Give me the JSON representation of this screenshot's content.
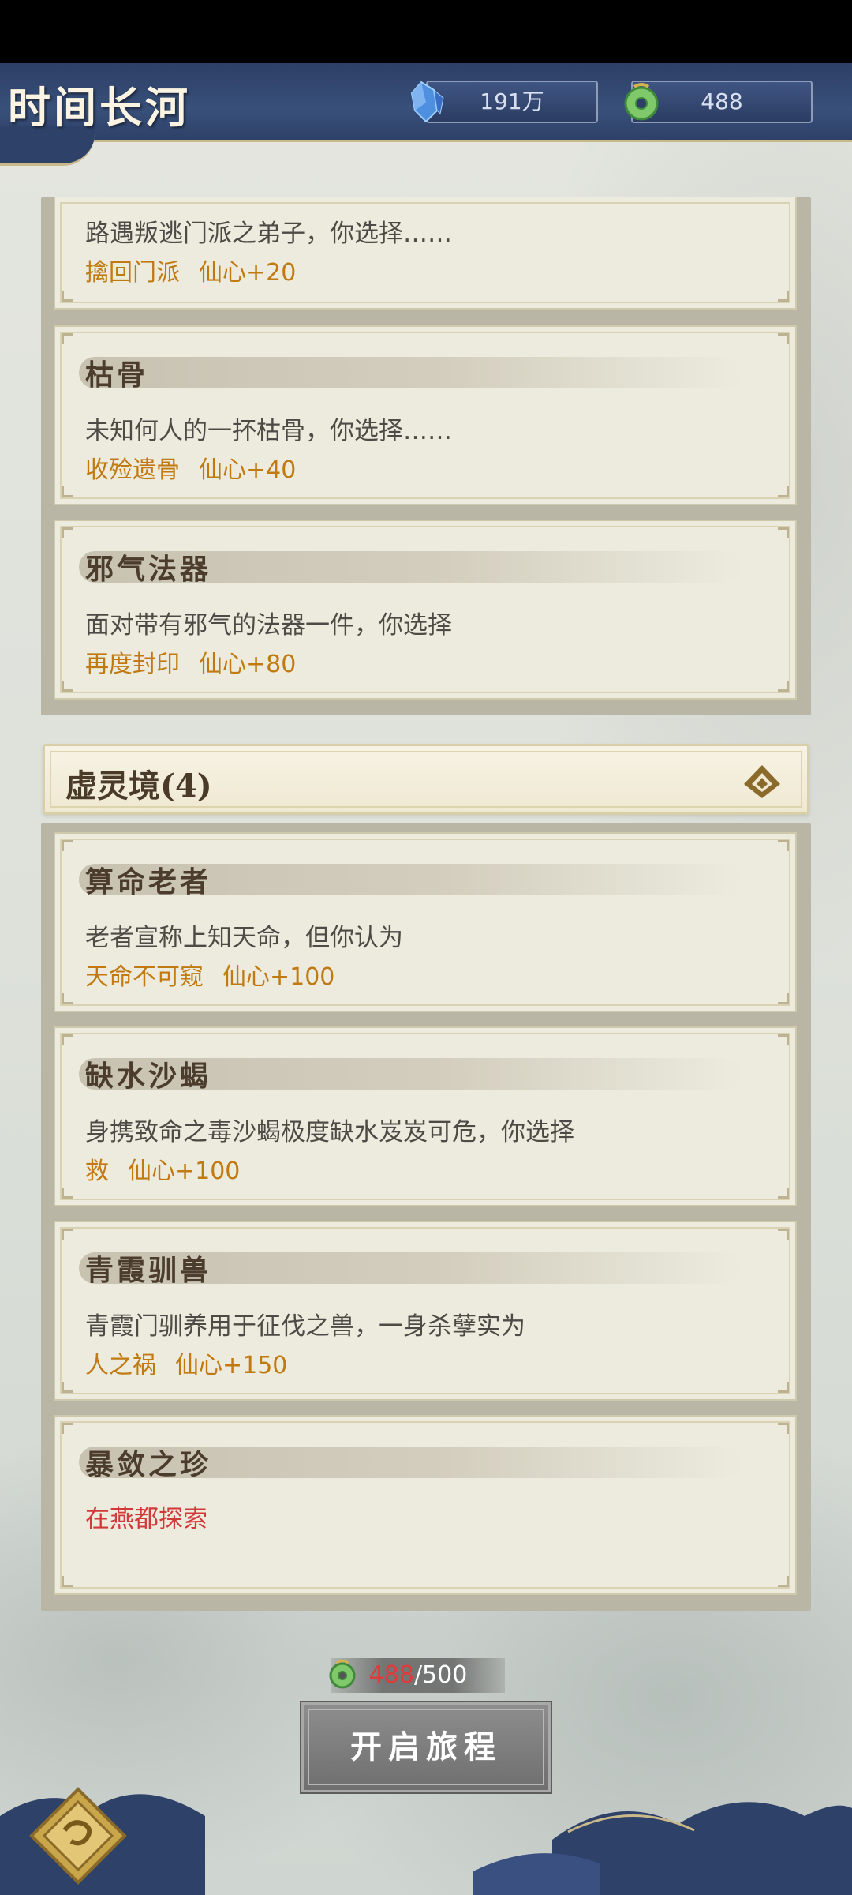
{
  "header": {
    "title": "时间长河",
    "currency_crystal": "191万",
    "currency_jade": "488",
    "crystal_icon": "crystal-icon",
    "jade_icon": "jade-coin-icon"
  },
  "section_prev": {
    "cards": [
      {
        "desc": "路遇叛逃门派之弟子，你选择……",
        "choice": "擒回门派",
        "gain": "仙心+20"
      },
      {
        "title": "枯骨",
        "desc": "未知何人的一抔枯骨，你选择……",
        "choice": "收殓遗骨",
        "gain": "仙心+40"
      },
      {
        "title": "邪气法器",
        "desc": "面对带有邪气的法器一件，你选择",
        "choice": "再度封印",
        "gain": "仙心+80"
      }
    ]
  },
  "section_xuling": {
    "title": "虚灵境(4)",
    "collapse_icon": "collapse-up-icon",
    "cards": [
      {
        "title": "算命老者",
        "desc": "老者宣称上知天命，但你认为",
        "choice": "天命不可窥",
        "gain": "仙心+100"
      },
      {
        "title": "缺水沙蝎",
        "desc": "身携致命之毒沙蝎极度缺水岌岌可危，你选择",
        "choice": "救",
        "gain": "仙心+100"
      },
      {
        "title": "青霞驯兽",
        "desc": "青霞门驯养用于征伐之兽，一身杀孽实为",
        "choice": "人之祸",
        "gain": "仙心+150"
      },
      {
        "title": "暴敛之珍",
        "hint": "在燕都探索"
      }
    ]
  },
  "footer": {
    "cost_have": "488",
    "cost_total": "/500",
    "start_label": "开启旅程",
    "menu_icon": "menu-diamond-icon"
  },
  "colors": {
    "header_bg": "#2e4168",
    "choice_text": "#c07a10",
    "alert_text": "#d23a3a",
    "card_bg": "#ecebde"
  }
}
